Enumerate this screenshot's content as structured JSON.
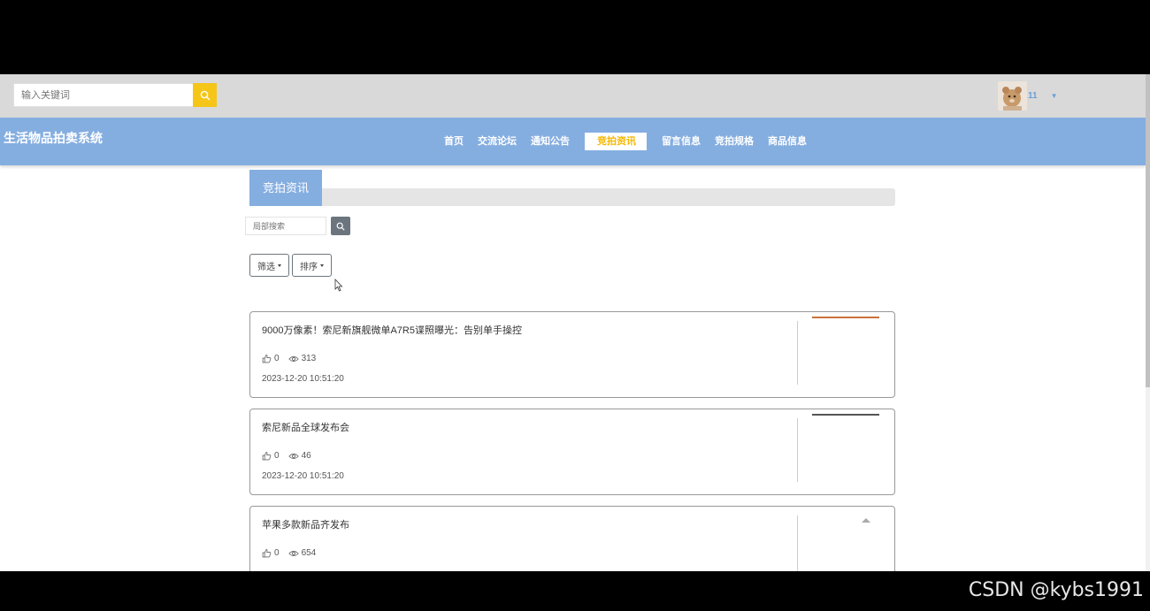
{
  "search": {
    "placeholder": "输入关键词"
  },
  "user": {
    "name": "11"
  },
  "site": {
    "title": "生活物品拍卖系统"
  },
  "nav": {
    "items": [
      {
        "label": "首页",
        "active": false
      },
      {
        "label": "交流论坛",
        "active": false
      },
      {
        "label": "通知公告",
        "active": false
      },
      {
        "label": "竞拍资讯",
        "active": true
      },
      {
        "label": "留言信息",
        "active": false
      },
      {
        "label": "竞拍规格",
        "active": false
      },
      {
        "label": "商品信息",
        "active": false
      }
    ]
  },
  "section": {
    "title": "竞拍资讯"
  },
  "local_search": {
    "placeholder": "局部搜索"
  },
  "filters": {
    "filter_label": "筛选",
    "sort_label": "排序"
  },
  "news": [
    {
      "title": "9000万像素！索尼新旗舰微单A7R5谍照曝光：告别单手操控",
      "likes": "0",
      "views": "313",
      "date": "2023-12-20 10:51:20"
    },
    {
      "title": "索尼新品全球发布会",
      "likes": "0",
      "views": "46",
      "date": "2023-12-20 10:51:20"
    },
    {
      "title": "苹果多款新品齐发布",
      "likes": "0",
      "views": "654",
      "date": ""
    }
  ],
  "watermark": "CSDN @kybs1991",
  "colors": {
    "nav_bg": "#85aee0",
    "accent": "#f5c518",
    "active_text": "#f5b800"
  }
}
